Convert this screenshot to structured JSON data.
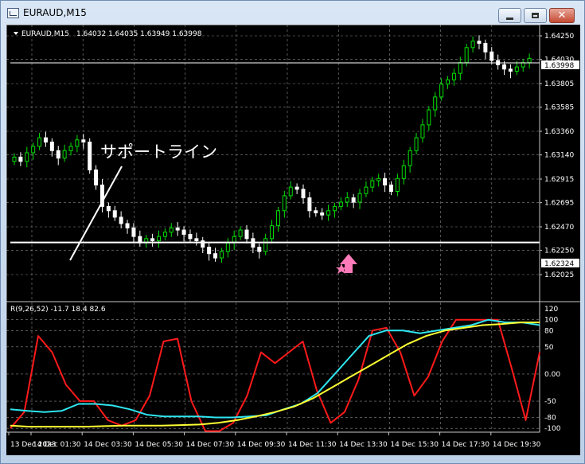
{
  "window": {
    "title": "EURAUD,M15"
  },
  "chart": {
    "header": "EURAUD,M15",
    "ohlc": "1.64032 1.64035 1.63949 1.63998",
    "annotation": "サポートライン",
    "price_ticks": [
      "1.64250",
      "1.64030",
      "1.63805",
      "1.63585",
      "1.63360",
      "1.63140",
      "1.62915",
      "1.62695",
      "1.62470",
      "1.62250",
      "1.62025"
    ],
    "current_price": "1.63998",
    "support_price": "1.62324",
    "indicator_label": "R(9,26,52) -11.7 18.4 82.6",
    "indicator_ticks": [
      "120",
      "100",
      "80",
      "50",
      "0.00",
      "-50",
      "-80",
      "-100"
    ],
    "time_labels": [
      "13 Dec 2023",
      "14 Dec 01:30",
      "14 Dec 03:30",
      "14 Dec 05:30",
      "14 Dec 07:30",
      "14 Dec 09:30",
      "14 Dec 11:30",
      "14 Dec 13:30",
      "14 Dec 15:30",
      "14 Dec 17:30",
      "14 Dec 19:30"
    ],
    "colors": {
      "background": "#000000",
      "grid": "#8a8a8a",
      "bull": "#00e000",
      "bear": "#ffffff",
      "support": "#ffffff",
      "fast": "#ff1a1a",
      "mid": "#2ee6f0",
      "slow": "#ffff33",
      "arrow": "#ff7ab8"
    }
  },
  "chart_data": {
    "type": "line",
    "price_axis_ticks": [
      1.6425,
      1.6403,
      1.63805,
      1.63585,
      1.6336,
      1.6314,
      1.62915,
      1.62695,
      1.6247,
      1.6225,
      1.62025
    ],
    "current_price": 1.63998,
    "support_line": 1.62324,
    "candle_closes": [
      1.6312,
      1.6308,
      1.6316,
      1.6322,
      1.633,
      1.6326,
      1.6318,
      1.6311,
      1.6318,
      1.6322,
      1.6328,
      1.6326,
      1.63,
      1.6286,
      1.6266,
      1.6262,
      1.6256,
      1.625,
      1.6246,
      1.6238,
      1.6232,
      1.6236,
      1.6234,
      1.6238,
      1.6242,
      1.6246,
      1.6244,
      1.624,
      1.6236,
      1.6234,
      1.6228,
      1.6222,
      1.6218,
      1.6224,
      1.6232,
      1.6238,
      1.6244,
      1.6236,
      1.6228,
      1.6224,
      1.6236,
      1.6248,
      1.6262,
      1.6276,
      1.6284,
      1.6282,
      1.6274,
      1.6262,
      1.626,
      1.6258,
      1.6262,
      1.6266,
      1.627,
      1.6274,
      1.627,
      1.6278,
      1.6284,
      1.629,
      1.6292,
      1.6286,
      1.628,
      1.6292,
      1.6304,
      1.6318,
      1.633,
      1.6342,
      1.6356,
      1.6368,
      1.638,
      1.6384,
      1.639,
      1.64,
      1.6414,
      1.642,
      1.6418,
      1.641,
      1.6402,
      1.6398,
      1.6394,
      1.6392,
      1.6396,
      1.64,
      1.6404
    ],
    "indicator": {
      "ylim": [
        -110,
        120
      ],
      "series": [
        {
          "color": "#ff1a1a",
          "values": [
            -100,
            -70,
            70,
            40,
            -20,
            -50,
            -50,
            -85,
            -95,
            -85,
            -40,
            60,
            65,
            -50,
            -105,
            -105,
            -90,
            -40,
            40,
            20,
            40,
            60,
            -30,
            -90,
            -70,
            -10,
            80,
            85,
            40,
            -40,
            -5,
            60,
            100,
            100,
            100,
            100,
            10,
            -85,
            40
          ]
        },
        {
          "color": "#2ee6f0",
          "values": [
            -65,
            -68,
            -70,
            -68,
            -55,
            -55,
            -58,
            -65,
            -75,
            -78,
            -78,
            -78,
            -80,
            -80,
            -78,
            -76,
            -65,
            -55,
            -35,
            0,
            35,
            70,
            80,
            80,
            75,
            80,
            85,
            90,
            100,
            95,
            95,
            90
          ]
        },
        {
          "color": "#ffff33",
          "values": [
            -95,
            -97,
            -97,
            -97,
            -97,
            -96,
            -95,
            -95,
            -95,
            -94,
            -93,
            -90,
            -85,
            -78,
            -70,
            -60,
            -45,
            -25,
            -5,
            15,
            35,
            55,
            70,
            80,
            85,
            90,
            92,
            95,
            95
          ]
        }
      ]
    }
  }
}
